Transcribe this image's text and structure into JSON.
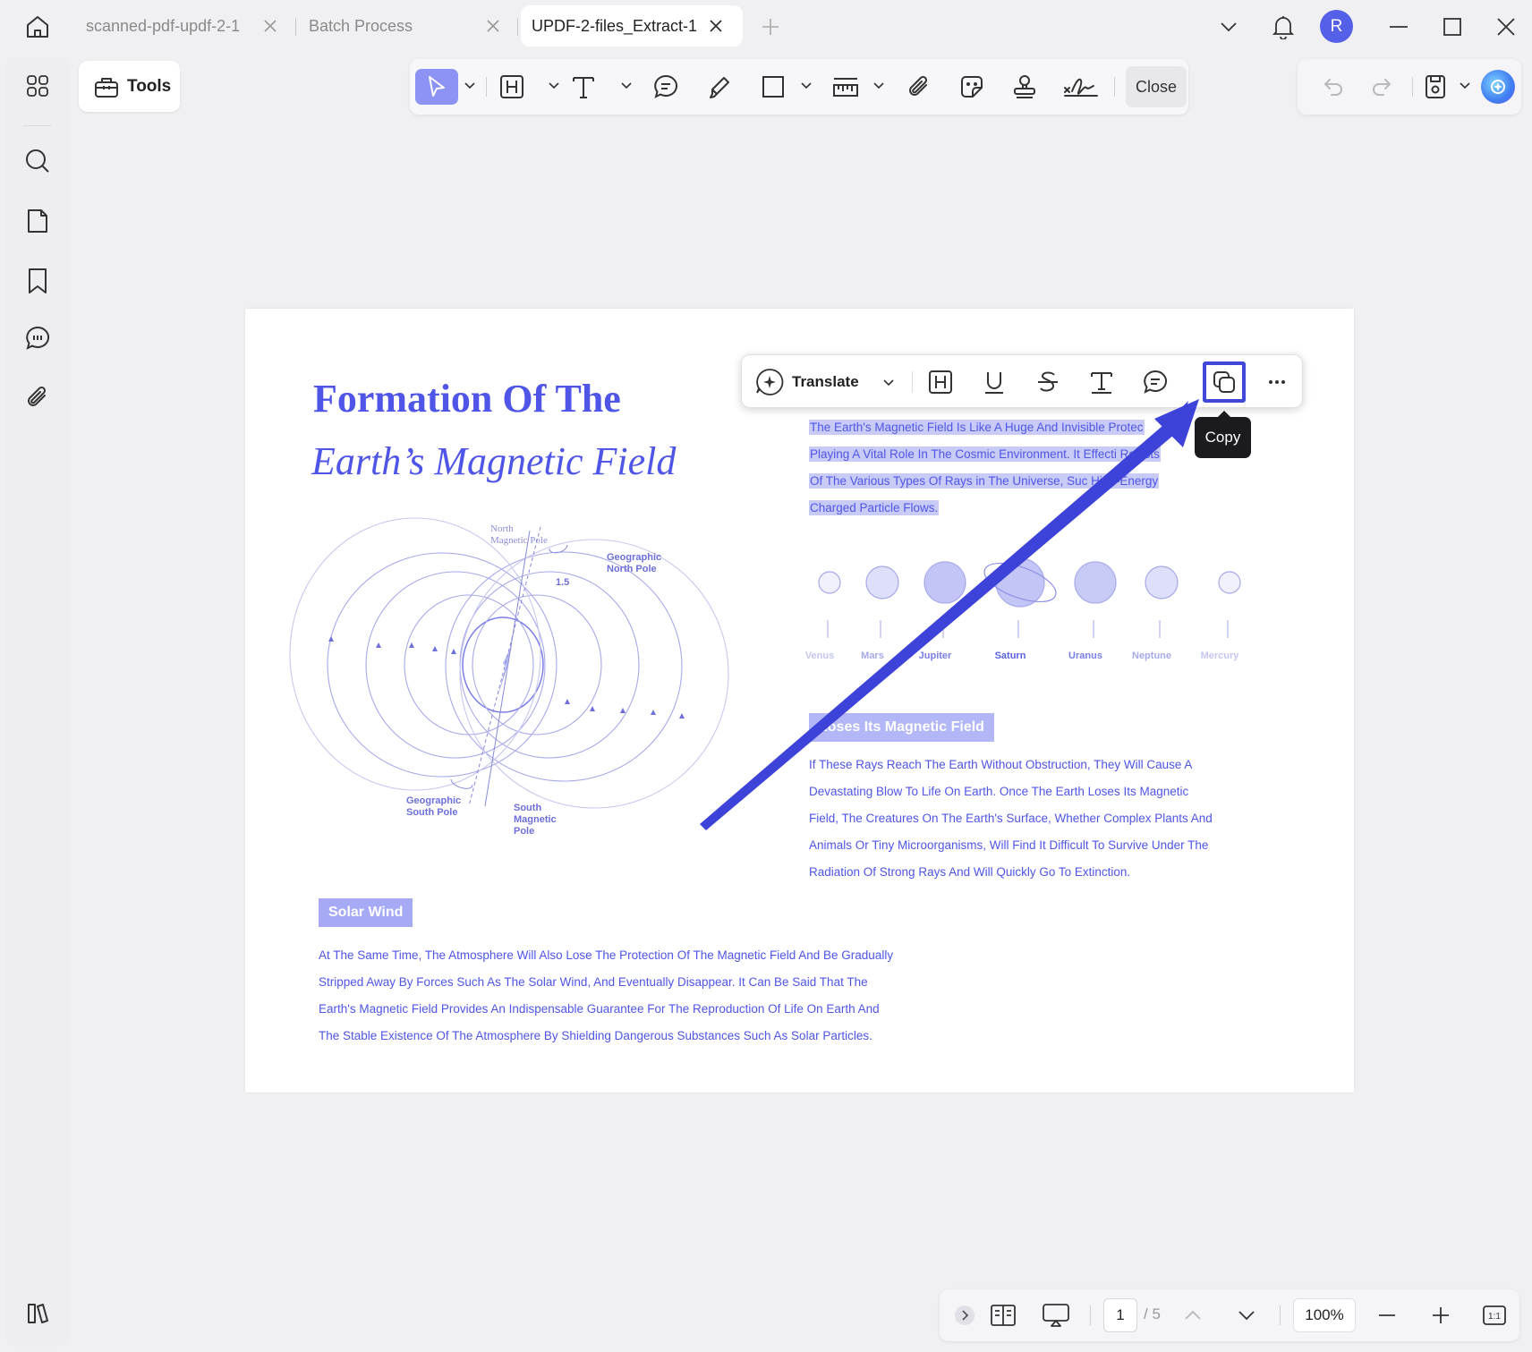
{
  "tabs": [
    {
      "label": "scanned-pdf-updf-2-1",
      "active": false
    },
    {
      "label": "Batch Process",
      "active": false
    },
    {
      "label": "UPDF-2-files_Extract-1",
      "active": true
    }
  ],
  "user": {
    "avatar_initial": "R"
  },
  "toolbar": {
    "tools_label": "Tools",
    "close_label": "Close"
  },
  "document": {
    "title_line1": "Formation Of The",
    "title_line2": "Earth’s Magnetic Field",
    "diagram_labels": {
      "north_magnetic_pole": "North\nMagnetic Pole",
      "geographic_north_pole": "Geographic\nNorth Pole",
      "angle": "1.5",
      "geographic_south_pole": "Geographic\nSouth Pole",
      "south_magnetic_pole": "South\nMagnetic\nPole"
    },
    "highlighted_lines": [
      "The Earth's Magnetic Field Is Like A Huge And Invisible Protec",
      "Playing A Vital Role In The Cosmic Environment. It Effecti    Resists",
      "Of The Various Types Of Rays in The Universe, Suc    High-Energy",
      "Charged Particle Flows."
    ],
    "planets": [
      "Venus",
      "Mars",
      "Jupiter",
      "Saturn",
      "Uranus",
      "Neptune",
      "Mercury"
    ],
    "section_loses": "Loses Its Magnetic Field",
    "loses_paragraph": [
      "If These Rays Reach The Earth Without Obstruction, They Will Cause A",
      "Devastating Blow To Life On Earth. Once The Earth Loses Its Magnetic",
      "Field, The Creatures On The Earth's Surface, Whether Complex Plants And",
      "Animals Or Tiny Microorganisms, Will Find It Difficult To Survive Under The",
      "Radiation Of Strong Rays And Will Quickly Go To Extinction."
    ],
    "section_solar": "Solar Wind",
    "solar_paragraph": [
      "At The Same Time, The Atmosphere Will Also Lose The Protection Of The Magnetic Field And Be Gradually",
      "Stripped Away By Forces Such As The Solar Wind, And Eventually Disappear. It Can Be Said That The",
      "Earth's Magnetic Field Provides An Indispensable Guarantee For The Reproduction Of Life On Earth And",
      "The Stable Existence Of The Atmosphere By Shielding Dangerous Substances Such As Solar Particles."
    ]
  },
  "selection_toolbar": {
    "translate_label": "Translate",
    "tooltip": "Copy"
  },
  "bottom_bar": {
    "current_page": "1",
    "total_pages": "/ 5",
    "zoom": "100%",
    "fit_label": "1:1"
  },
  "colors": {
    "accent": "#4f55e6",
    "highlight": "#c9cbf7",
    "annotation_arrow": "#3d43d8",
    "active_tool": "#8d93f5"
  }
}
